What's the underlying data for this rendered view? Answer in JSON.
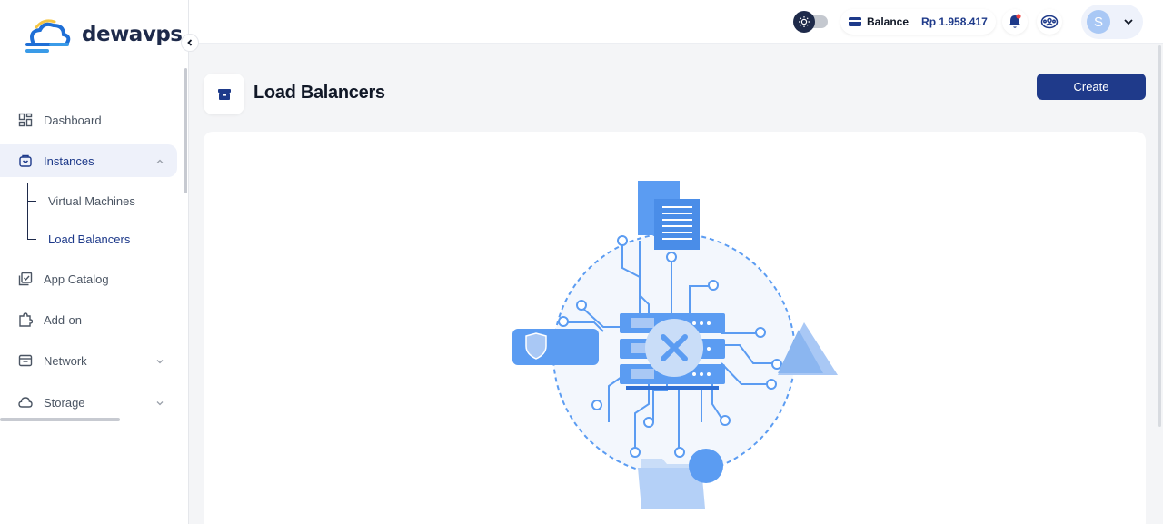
{
  "brand": {
    "name": "dewavps"
  },
  "sidebar": {
    "items": [
      {
        "label": "Dashboard",
        "icon": "dashboard-icon"
      },
      {
        "label": "Instances",
        "icon": "instances-icon",
        "expanded": true
      },
      {
        "label": "App Catalog",
        "icon": "app-catalog-icon"
      },
      {
        "label": "Add-on",
        "icon": "puzzle-icon"
      },
      {
        "label": "Network",
        "icon": "network-icon"
      },
      {
        "label": "Storage",
        "icon": "cloud-icon"
      }
    ],
    "instances_sub": [
      {
        "label": "Virtual Machines"
      },
      {
        "label": "Load Balancers",
        "active": true
      }
    ]
  },
  "header": {
    "balance_label": "Balance",
    "balance_amount": "Rp 1.958.417",
    "user_initial": "S"
  },
  "page": {
    "title": "Load Balancers",
    "create_label": "Create"
  },
  "colors": {
    "primary": "#1f3a8a",
    "accent_blue": "#5b9cf2",
    "light_blue": "#a9c8f5",
    "notification": "#ef4444"
  }
}
